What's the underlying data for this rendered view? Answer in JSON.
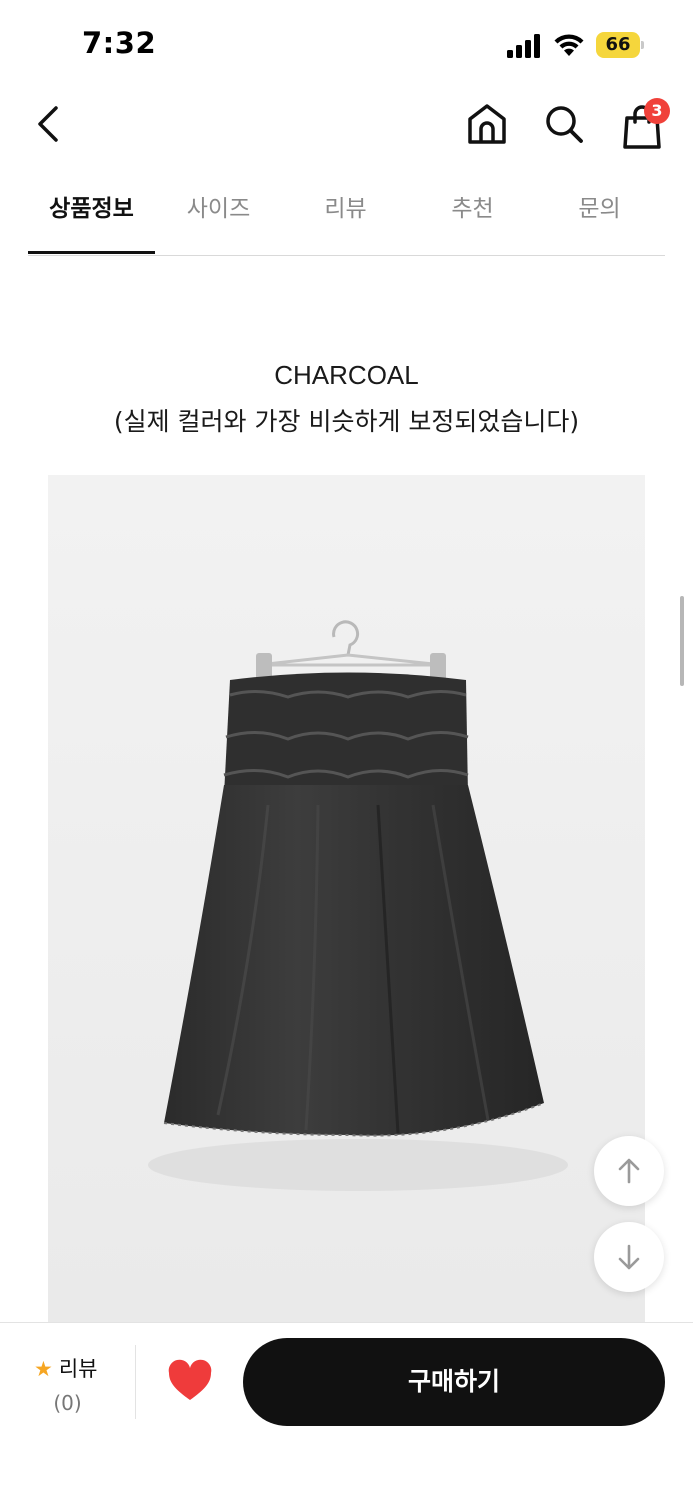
{
  "status_bar": {
    "time": "7:32",
    "battery": "66"
  },
  "header": {
    "back_icon": "chevron-left-icon",
    "home_icon": "home-icon",
    "search_icon": "search-icon",
    "cart_icon": "shopping-bag-icon",
    "cart_count": "3"
  },
  "tabs": [
    {
      "label": "상품정보",
      "active": true
    },
    {
      "label": "사이즈",
      "active": false
    },
    {
      "label": "리뷰",
      "active": false
    },
    {
      "label": "추천",
      "active": false
    },
    {
      "label": "문의",
      "active": false
    }
  ],
  "content": {
    "color_name": "CHARCOAL",
    "color_note": "(실제 컬러와 가장 비슷하게 보정되었습니다)"
  },
  "floating": {
    "up_icon": "arrow-up-icon",
    "down_icon": "arrow-down-icon"
  },
  "bottom_bar": {
    "review_label": "리뷰",
    "review_count": "(0)",
    "heart_icon": "heart-icon",
    "buy_label": "구매하기"
  },
  "colors": {
    "accent": "#111111",
    "badge": "#f0413a",
    "heart": "#ef3b3b",
    "star": "#f6a623",
    "battery": "#f5d63c"
  }
}
